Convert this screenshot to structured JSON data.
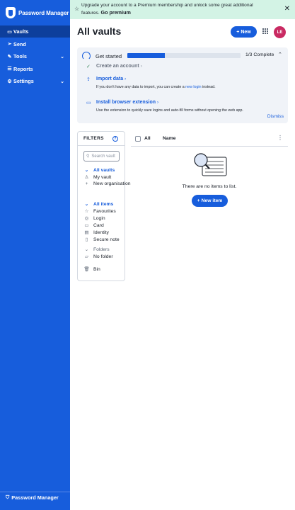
{
  "sidebar": {
    "brand": "Password Manager",
    "items": [
      {
        "label": "Vaults",
        "icon": "vault-icon",
        "active": true
      },
      {
        "label": "Send",
        "icon": "send-icon"
      },
      {
        "label": "Tools",
        "icon": "tools-icon",
        "expandable": true
      },
      {
        "label": "Reports",
        "icon": "reports-icon"
      },
      {
        "label": "Settings",
        "icon": "settings-icon",
        "expandable": true
      }
    ],
    "footer": "Password Manager"
  },
  "banner": {
    "message": "Upgrade your account to a Premium membership and unlock some great additional features.",
    "cta": "Go premium"
  },
  "header": {
    "title": "All vaults",
    "new_label": "New",
    "avatar_initials": "LE",
    "avatar_color": "#c92a62"
  },
  "getting_started": {
    "title": "Get started",
    "progress": 0.33,
    "count": "1/3 Complete",
    "tasks": [
      {
        "title": "Create an account",
        "done": true
      },
      {
        "title": "Import data",
        "desc_before": "If you don't have any data to import, you can create a",
        "desc_link": "new login",
        "desc_after": "instead."
      },
      {
        "title": "Install browser extension",
        "desc": "Use the extension to quickly save logins and auto-fill forms without opening the web app."
      }
    ],
    "dismiss": "Dismiss"
  },
  "filters": {
    "title": "FILTERS",
    "search_placeholder": "Search vault",
    "vaults_heading": "All vaults",
    "vault_items": [
      "My vault",
      "New organisation"
    ],
    "items_heading": "All items",
    "type_items": [
      "Favourites",
      "Login",
      "Card",
      "Identity",
      "Secure note"
    ],
    "folders_heading": "Folders",
    "folder_items": [
      "No folder"
    ],
    "bin": "Bin"
  },
  "table": {
    "col_all": "All",
    "col_name": "Name",
    "empty_text": "There are no items to list.",
    "new_item_label": "New item"
  },
  "colors": {
    "accent": "#175ddc",
    "banner_bg": "#d3f3e5"
  }
}
